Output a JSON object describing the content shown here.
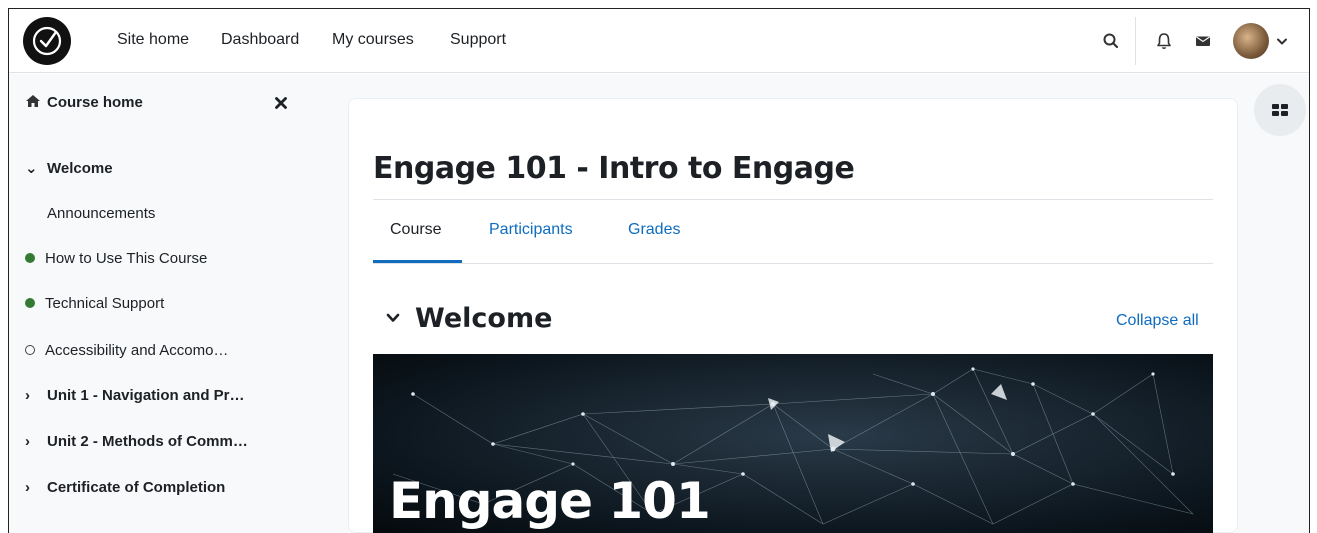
{
  "nav": {
    "links": [
      "Site home",
      "Dashboard",
      "My courses",
      "Support"
    ],
    "icons": [
      "search-icon",
      "bell-icon",
      "envelope-icon",
      "user-avatar",
      "chevron-down-icon"
    ]
  },
  "drawer": {
    "header": "Course home",
    "close_icon": "close-icon",
    "items": [
      {
        "label": "Welcome",
        "type": "section",
        "expanded": true
      },
      {
        "label": "Announcements",
        "type": "activity"
      },
      {
        "label": "How to Use This Course",
        "type": "activity",
        "status": "complete"
      },
      {
        "label": "Technical Support",
        "type": "activity",
        "status": "complete"
      },
      {
        "label": "Accessibility and Accomo…",
        "type": "activity",
        "status": "incomplete"
      },
      {
        "label": "Unit 1 - Navigation and Pr…",
        "type": "section",
        "expanded": false
      },
      {
        "label": "Unit 2 - Methods of Comm…",
        "type": "section",
        "expanded": false
      },
      {
        "label": "Certificate of Completion",
        "type": "section",
        "expanded": false
      }
    ]
  },
  "course": {
    "title": "Engage 101 - Intro to Engage",
    "tabs": [
      "Course",
      "Participants",
      "Grades"
    ],
    "active_tab": "Course",
    "section_title": "Welcome",
    "collapse_all": "Collapse all",
    "banner_text": "Engage 101"
  },
  "colors": {
    "link": "#0f6cbf",
    "complete": "#357a32",
    "drawer_bg": "#f8f9fa"
  }
}
